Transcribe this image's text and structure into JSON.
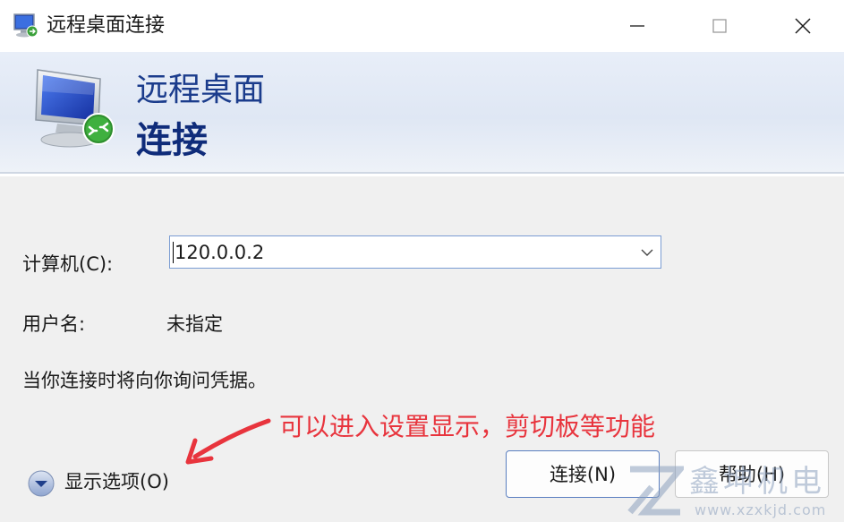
{
  "window": {
    "title": "远程桌面连接",
    "icon": "remote-desktop-icon"
  },
  "banner": {
    "line1": "远程桌面",
    "line2": "连接",
    "icon": "monitor-remote-icon"
  },
  "form": {
    "computer_label": "计算机(C):",
    "computer_value": "120.0.0.2",
    "username_label": "用户名:",
    "username_value": "未指定",
    "info": "当你连接时将向你询问凭据。"
  },
  "annotation": {
    "text": "可以进入设置显示，剪切板等功能",
    "color": "#e8343d"
  },
  "options": {
    "label": "显示选项(O)",
    "icon": "chevron-down-circle-icon"
  },
  "buttons": {
    "connect": "连接(N)",
    "help": "帮助(H)"
  },
  "watermark": {
    "name": "鑫坤机电",
    "url": "www.xzxkjd.com"
  },
  "colors": {
    "banner_title": "#1b3c8c",
    "accent_border": "#7a9cd3"
  }
}
